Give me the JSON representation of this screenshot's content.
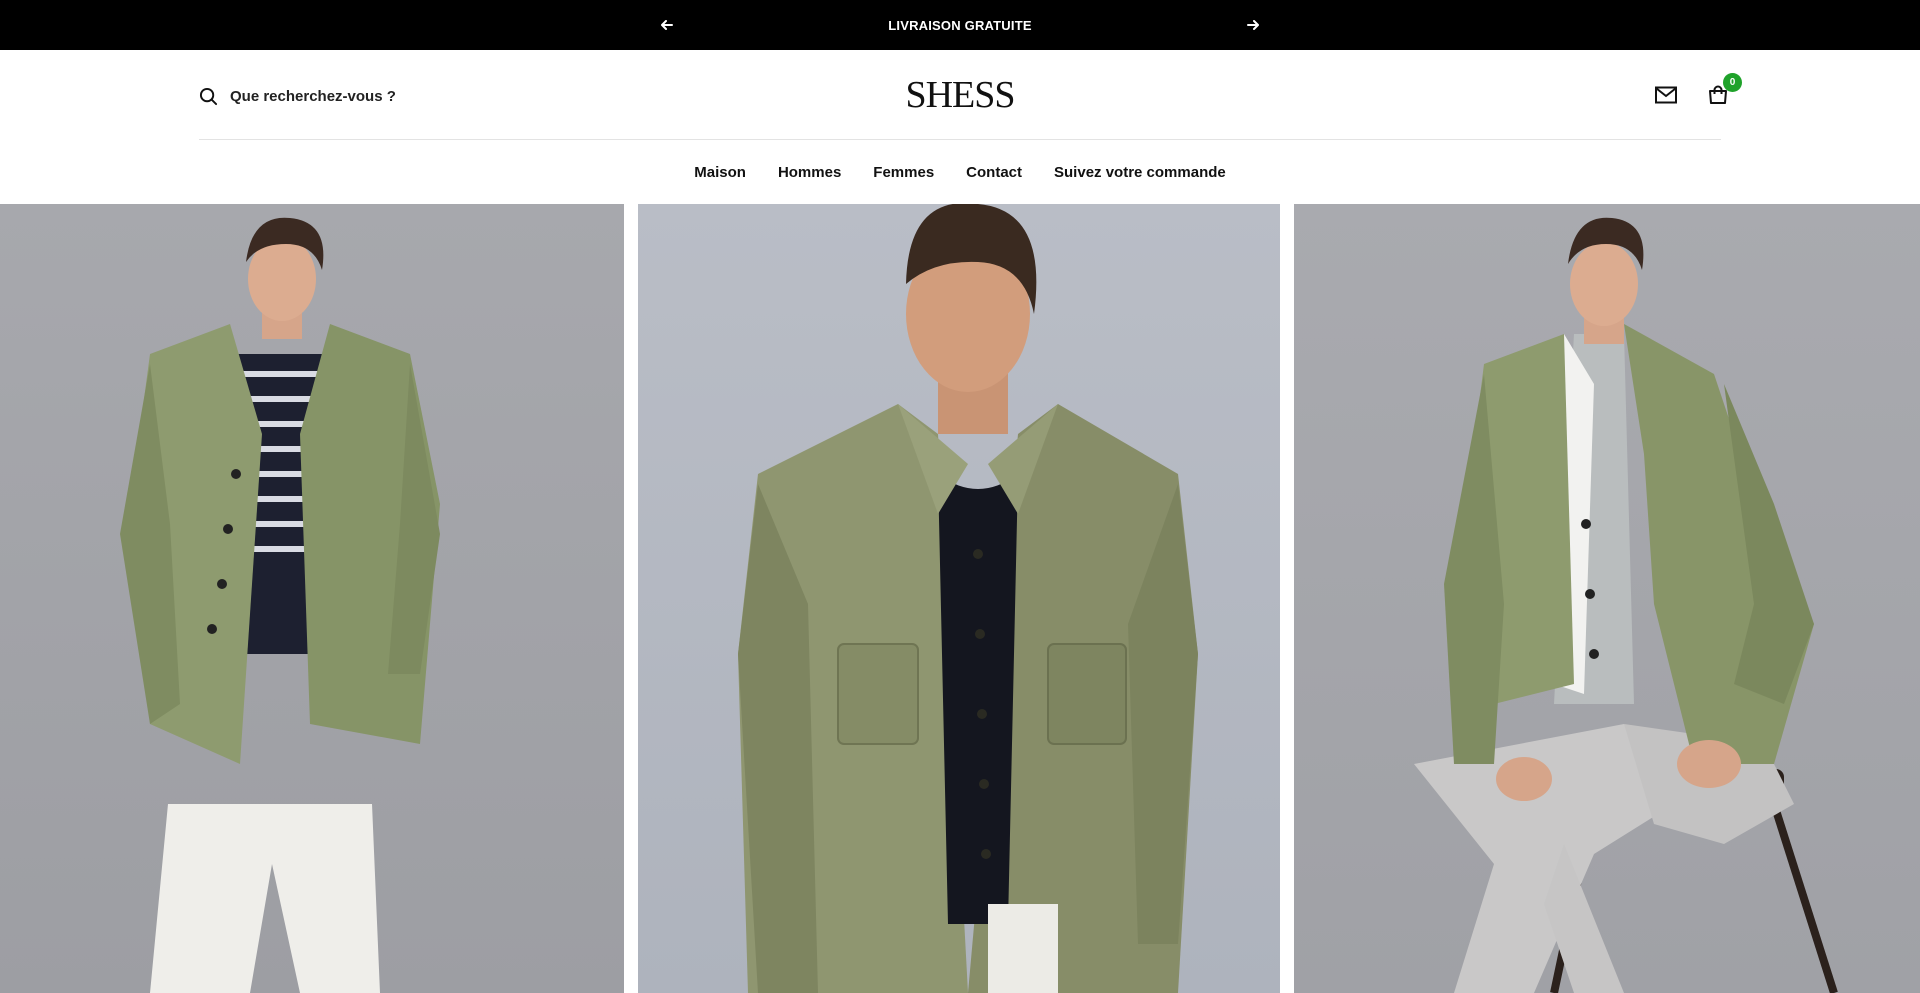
{
  "announcement": {
    "message": "LIVRAISON GRATUITE",
    "prev_icon": "arrow-left-icon",
    "next_icon": "arrow-right-icon"
  },
  "header": {
    "search": {
      "placeholder": "Que recherchez-vous ?",
      "icon": "search-icon"
    },
    "logo": "SHESS",
    "contact_icon": "mail-icon",
    "cart": {
      "icon": "cart-icon",
      "count": "0"
    }
  },
  "nav": {
    "items": [
      {
        "label": "Maison"
      },
      {
        "label": "Hommes"
      },
      {
        "label": "Femmes"
      },
      {
        "label": "Contact"
      },
      {
        "label": "Suivez votre commande"
      }
    ]
  },
  "colors": {
    "announcement_bg": "#000000",
    "cart_badge": "#1fa22a",
    "jacket": "#8c9a6e",
    "background": "#ffffff"
  }
}
